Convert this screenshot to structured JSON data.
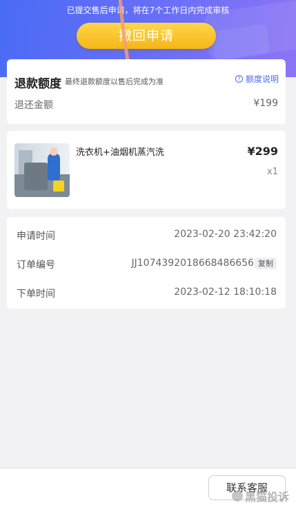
{
  "header": {
    "notice": "已提交售后申请，将在7个工作日内完成审核",
    "withdraw_button": "撤回申请"
  },
  "refund": {
    "title": "退款额度",
    "subtitle": "最终退款额度以售后完成为准",
    "help_label": "额度说明",
    "amount_label": "退还金额",
    "amount_value": "¥199"
  },
  "product": {
    "name": "洗衣机+油烟机蒸汽洗",
    "price": "¥299",
    "quantity": "x1"
  },
  "info": {
    "apply_time_label": "申请时间",
    "apply_time_value": "2023-02-20 23:42:20",
    "order_no_label": "订单编号",
    "order_no_value": "JJ1074392018668486656",
    "copy_label": "复制",
    "order_time_label": "下单时间",
    "order_time_value": "2023-02-12 18:10:18"
  },
  "footer": {
    "contact_button": "联系客服",
    "watermark": "黑猫投诉"
  },
  "colors": {
    "accent": "#4a6bf5",
    "button_gold": "#f5b616"
  }
}
